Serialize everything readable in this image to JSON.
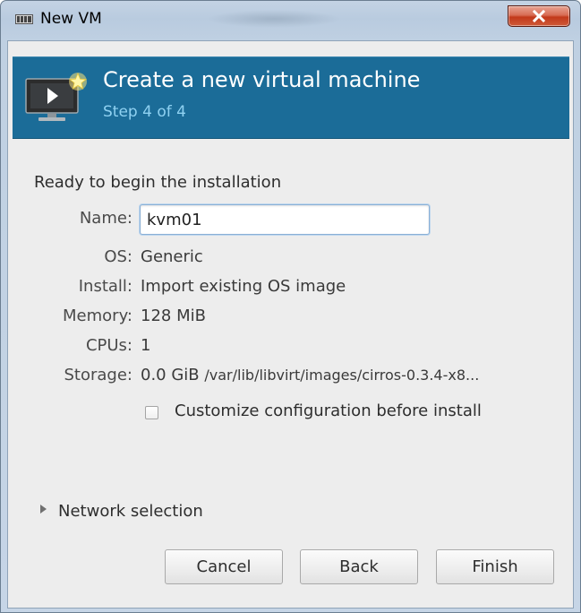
{
  "window": {
    "title": "New VM",
    "icon": "vm-manager-icon",
    "close_icon": "close-icon"
  },
  "banner": {
    "title": "Create a new virtual machine",
    "subtitle": "Step 4 of 4",
    "icon": "virtual-machine-monitor-icon",
    "background_color": "#1b6c98",
    "subtitle_color": "#8fd1f1"
  },
  "summary": {
    "heading": "Ready to begin the installation",
    "name_label": "Name:",
    "name_value": "kvm01",
    "os_label": "OS:",
    "os_value": "Generic",
    "install_label": "Install:",
    "install_value": "Import existing OS image",
    "memory_label": "Memory:",
    "memory_value": "128 MiB",
    "cpus_label": "CPUs:",
    "cpus_value": "1",
    "storage_label": "Storage:",
    "storage_size": "0.0 GiB",
    "storage_path": "/var/lib/libvirt/images/cirros-0.3.4-x8..."
  },
  "customize": {
    "label": "Customize configuration before install",
    "checked": false
  },
  "network": {
    "label": "Network selection",
    "expanded": false
  },
  "buttons": {
    "cancel": "Cancel",
    "back": "Back",
    "finish": "Finish"
  }
}
